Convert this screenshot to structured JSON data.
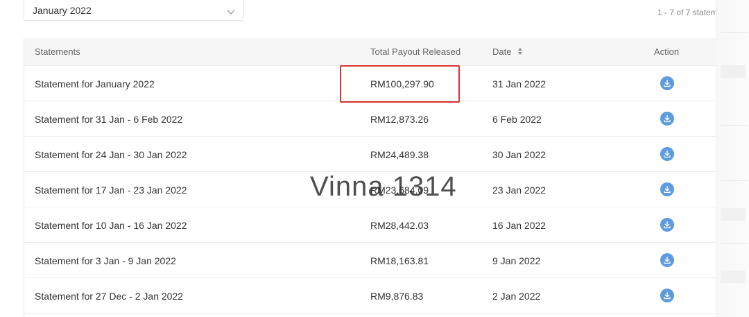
{
  "filter": {
    "month_value": "January 2022",
    "icon": "chevron-down-icon"
  },
  "pagination": {
    "count_text": "1 - 7 of 7 statem"
  },
  "table": {
    "headers": {
      "statements": "Statements",
      "total_payout": "Total Payout Released",
      "date": "Date",
      "action": "Action"
    },
    "rows": [
      {
        "statement": "Statement for January 2022",
        "payout": "RM100,297.90",
        "date": "31 Jan 2022"
      },
      {
        "statement": "Statement for 31 Jan - 6 Feb 2022",
        "payout": "RM12,873.26",
        "date": "6 Feb 2022"
      },
      {
        "statement": "Statement for 24 Jan - 30 Jan 2022",
        "payout": "RM24,489.38",
        "date": "30 Jan 2022"
      },
      {
        "statement": "Statement for 17 Jan - 23 Jan 2022",
        "payout": "RM23,684.09",
        "date": "23 Jan 2022"
      },
      {
        "statement": "Statement for 10 Jan - 16 Jan 2022",
        "payout": "RM28,442.03",
        "date": "16 Jan 2022"
      },
      {
        "statement": "Statement for 3 Jan - 9 Jan 2022",
        "payout": "RM18,163.81",
        "date": "9 Jan 2022"
      },
      {
        "statement": "Statement for 27 Dec - 2 Jan 2022",
        "payout": "RM9,876.83",
        "date": "2 Jan 2022"
      }
    ]
  },
  "watermark": "Vinna 1314",
  "colors": {
    "download_button": "#5b9bde",
    "highlight_border": "#d93232",
    "header_bg": "#f6f6f6"
  }
}
